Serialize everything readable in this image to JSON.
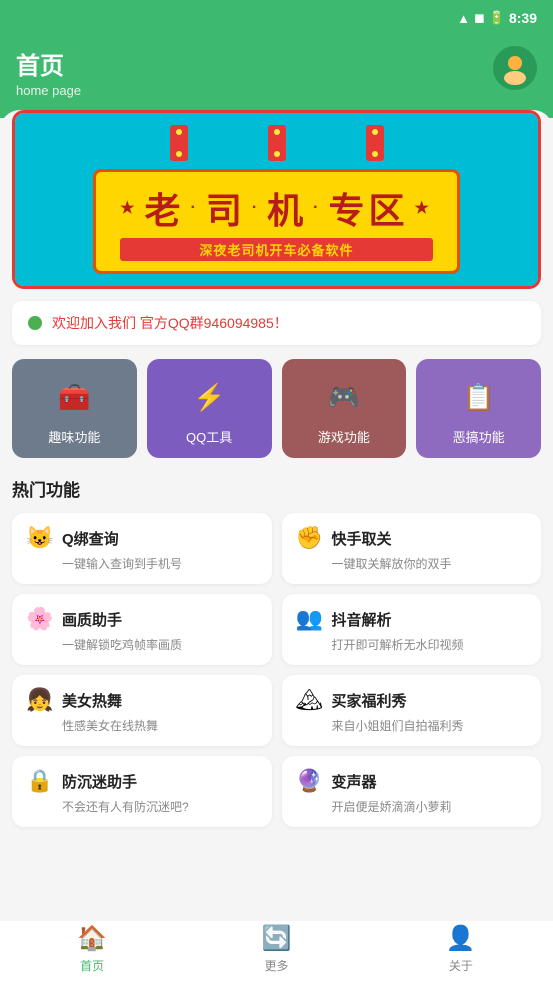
{
  "statusBar": {
    "time": "8:39"
  },
  "header": {
    "title": "首页",
    "subtitle": "home page"
  },
  "banner": {
    "mainText": "老·司·机·专区",
    "subText": "深夜老司机开车必备软件",
    "border_color": "#e53935"
  },
  "notice": {
    "text": "欢迎加入我们 官方QQ群946094985！"
  },
  "functionGrid": {
    "items": [
      {
        "label": "趣味功能",
        "icon": "🧰",
        "colorClass": "func-card-0"
      },
      {
        "label": "QQ工具",
        "icon": "⚡",
        "colorClass": "func-card-1"
      },
      {
        "label": "游戏功能",
        "icon": "🎮",
        "colorClass": "func-card-2"
      },
      {
        "label": "恶搞功能",
        "icon": "📋",
        "colorClass": "func-card-3"
      }
    ]
  },
  "hotSection": {
    "title": "热门功能",
    "items": [
      {
        "icon": "😺",
        "title": "Q绑查询",
        "desc": "一键输入查询到手机号"
      },
      {
        "icon": "✊",
        "title": "快手取关",
        "desc": "一键取关解放你的双手"
      },
      {
        "icon": "🌸",
        "title": "画质助手",
        "desc": "一键解锁吃鸡帧率画质"
      },
      {
        "icon": "👥",
        "title": "抖音解析",
        "desc": "打开即可解析无水印视频"
      },
      {
        "icon": "👧",
        "title": "美女热舞",
        "desc": "性感美女在线热舞"
      },
      {
        "icon": "🏔",
        "title": "买家福利秀",
        "desc": "来自小姐姐们自拍福利秀"
      },
      {
        "icon": "🔒",
        "title": "防沉迷助手",
        "desc": "不会还有人有防沉迷吧?"
      },
      {
        "icon": "🔮",
        "title": "变声器",
        "desc": "开启便是娇滴滴小萝莉"
      }
    ]
  },
  "bottomNav": {
    "items": [
      {
        "label": "首页",
        "icon": "🏠",
        "active": true
      },
      {
        "label": "更多",
        "icon": "🔄",
        "active": false
      },
      {
        "label": "关于",
        "icon": "👤",
        "active": false
      }
    ]
  }
}
